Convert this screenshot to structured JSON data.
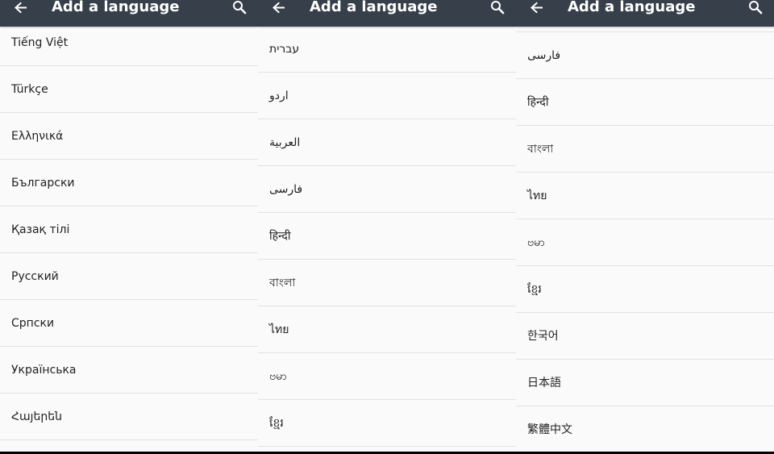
{
  "colors": {
    "appbar": "#37404a",
    "list_background": "#fafafa",
    "divider": "#e2e2e2",
    "text": "#222222"
  },
  "panels": [
    {
      "appbar": {
        "back_icon": "arrow-back-icon",
        "title": "Add a language",
        "search_icon": "search-icon"
      },
      "languages": [
        {
          "label": "Tiếng Việt"
        },
        {
          "label": "Türkçe"
        },
        {
          "label": "Ελληνικά"
        },
        {
          "label": "Български"
        },
        {
          "label": "Қазақ тілі"
        },
        {
          "label": "Русский"
        },
        {
          "label": "Српски"
        },
        {
          "label": "Українська"
        },
        {
          "label": "Հայերեն"
        }
      ]
    },
    {
      "appbar": {
        "back_icon": "arrow-back-icon",
        "title": "Add a language",
        "search_icon": "search-icon"
      },
      "languages": [
        {
          "label": "עברית"
        },
        {
          "label": "اردو"
        },
        {
          "label": "العربية"
        },
        {
          "label": "فارسی"
        },
        {
          "label": "हिन्दी"
        },
        {
          "label": "বাংলা"
        },
        {
          "label": "ไทย"
        },
        {
          "label": "ဗမာ"
        },
        {
          "label": "ខ្មែរ"
        }
      ]
    },
    {
      "appbar": {
        "back_icon": "arrow-back-icon",
        "title": "Add a language",
        "search_icon": "search-icon"
      },
      "languages": [
        {
          "label": "فارسی"
        },
        {
          "label": "हिन्दी"
        },
        {
          "label": "বাংলা"
        },
        {
          "label": "ไทย"
        },
        {
          "label": "ဗမာ"
        },
        {
          "label": "ខ្មែរ"
        },
        {
          "label": "한국어"
        },
        {
          "label": "日本語"
        },
        {
          "label": "繁體中文"
        }
      ]
    }
  ]
}
